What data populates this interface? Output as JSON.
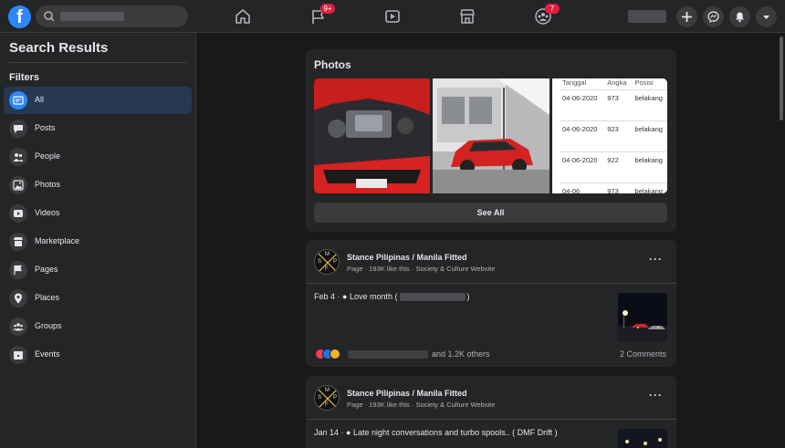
{
  "topbar": {
    "logo": "f",
    "search_placeholder": "",
    "nav": [
      {
        "icon": "home-icon"
      },
      {
        "icon": "flag-icon",
        "badge": "9+"
      },
      {
        "icon": "watch-icon"
      },
      {
        "icon": "marketplace-icon"
      },
      {
        "icon": "groups-icon",
        "badge": "7"
      }
    ],
    "actions": [
      "plus-icon",
      "messenger-icon",
      "bell-icon",
      "caret-down-icon"
    ],
    "accent_color": "#2d88ff",
    "badge_color": "#e41e3f"
  },
  "sidebar": {
    "title": "Search Results",
    "filters_label": "Filters",
    "items": [
      {
        "label": "All",
        "icon": "all-icon",
        "active": true
      },
      {
        "label": "Posts",
        "icon": "posts-icon"
      },
      {
        "label": "People",
        "icon": "people-icon"
      },
      {
        "label": "Photos",
        "icon": "photos-icon"
      },
      {
        "label": "Videos",
        "icon": "videos-icon"
      },
      {
        "label": "Marketplace",
        "icon": "marketplace-icon"
      },
      {
        "label": "Pages",
        "icon": "pages-icon"
      },
      {
        "label": "Places",
        "icon": "places-icon"
      },
      {
        "label": "Groups",
        "icon": "groups-icon"
      },
      {
        "label": "Events",
        "icon": "events-icon"
      }
    ]
  },
  "photos": {
    "title": "Photos",
    "see_all": "See All",
    "table": {
      "headers": [
        "Tanggal",
        "Angka",
        "Posisi"
      ],
      "rows": [
        [
          "04-06-2020",
          "973",
          "belakang"
        ],
        [
          "04-06-2020",
          "923",
          "belakang"
        ],
        [
          "04-06-2020",
          "922",
          "belakang"
        ],
        [
          "04-06",
          "973",
          "belakang"
        ]
      ]
    }
  },
  "posts": [
    {
      "page_name": "Stance Pilipinas / Manila Fitted",
      "meta": "Page · 193K like this · Society & Culture Website",
      "date": "Feb 4 ·",
      "text_before": "Love month (",
      "text_after": ")",
      "reactions_text": "and 1.2K others",
      "comments": "2 Comments"
    },
    {
      "page_name": "Stance Pilipinas / Manila Fitted",
      "meta": "Page · 193K like this · Society & Culture Website",
      "date": "Jan 14 ·",
      "text": "Late night conversations and turbo spools.. ( DMF Drift )"
    }
  ],
  "avatar_letters": [
    "M",
    "S",
    "P",
    "F"
  ]
}
